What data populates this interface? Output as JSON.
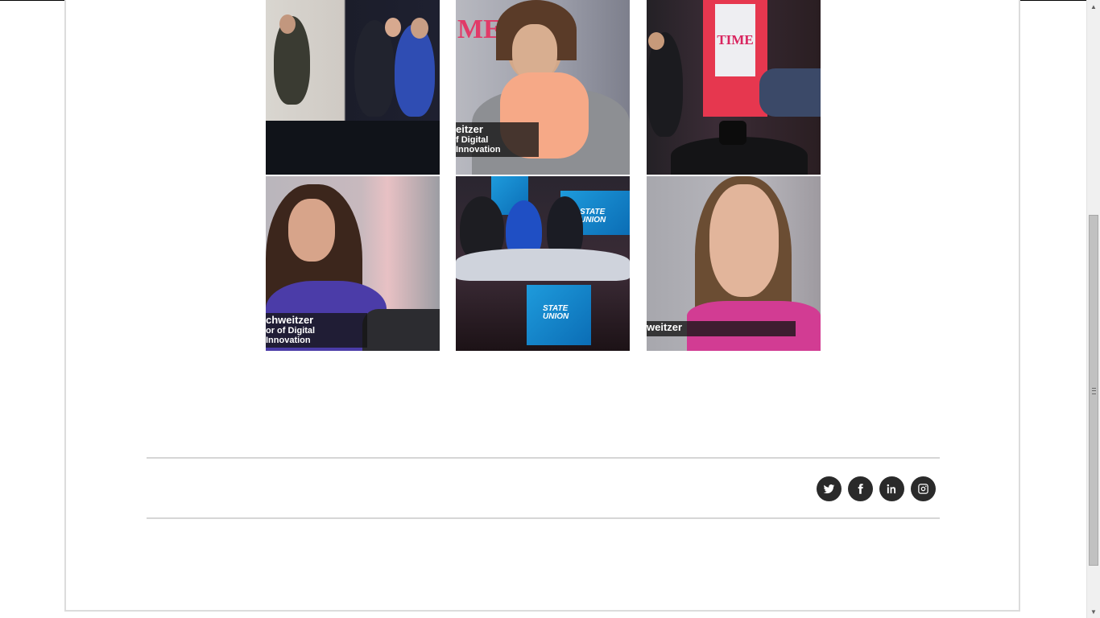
{
  "gallery": {
    "tiles": [
      {
        "id": "tile-1",
        "caption_name": "",
        "caption_title": ""
      },
      {
        "id": "tile-2",
        "caption_name": "eitzer",
        "caption_title": "f Digital Innovation",
        "logo": "ME"
      },
      {
        "id": "tile-3",
        "caption_name": "",
        "caption_title": "",
        "logo": "TIME"
      },
      {
        "id": "tile-4",
        "caption_name": "chweitzer",
        "caption_title": "or of Digital Innovation"
      },
      {
        "id": "tile-5",
        "caption_name": "",
        "caption_title": "",
        "screen_text_1": "STATE",
        "screen_text_2": "UNION"
      },
      {
        "id": "tile-6",
        "caption_name": "weitzer",
        "caption_title": ""
      }
    ]
  },
  "footer": {
    "social": [
      {
        "name": "twitter",
        "icon": "twitter-icon"
      },
      {
        "name": "facebook",
        "icon": "facebook-icon"
      },
      {
        "name": "linkedin",
        "icon": "linkedin-icon"
      },
      {
        "name": "instagram",
        "icon": "instagram-icon"
      }
    ]
  },
  "colors": {
    "time_red": "#d9245f",
    "icon_bg": "#2a2a2a",
    "rule": "#d6d6d6"
  }
}
